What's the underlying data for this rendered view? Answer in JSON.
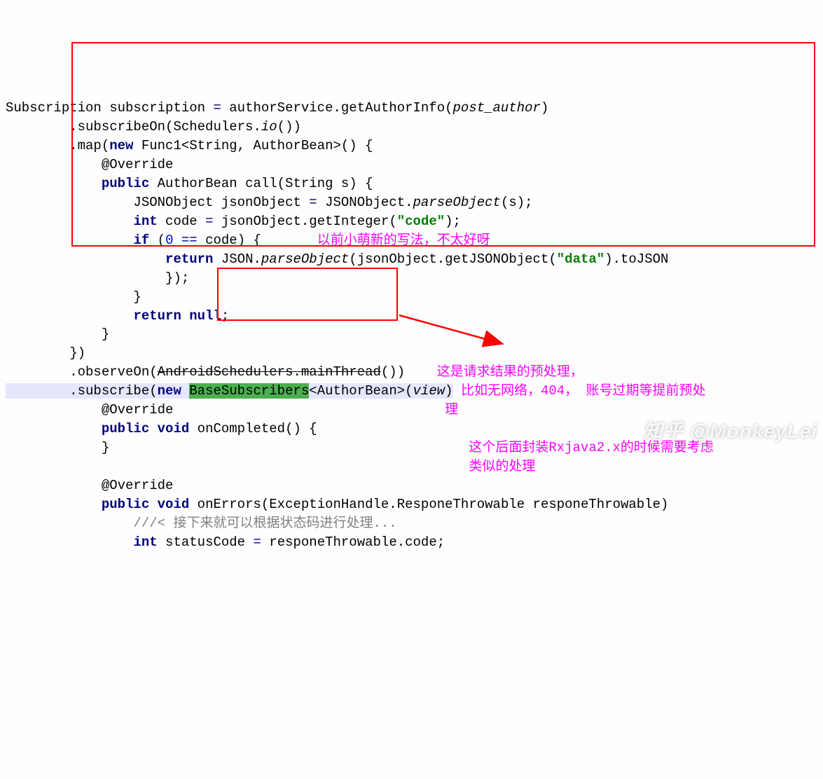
{
  "code": {
    "line1": {
      "pre": "Subscription subscription ",
      "op": "=",
      "post": " authorService.getAuthorInfo(",
      "arg": "post_author",
      "end": ")"
    },
    "line2": {
      "indent": "        .subscribeOn(Schedulers.",
      "method": "io",
      "end": "())"
    },
    "line3": {
      "indent": "        .map(",
      "kw": "new",
      "gen": " Func1<String, AuthorBean>",
      "end": "() {"
    },
    "line4": {
      "indent": "            ",
      "ann": "@Override"
    },
    "line5": {
      "indent": "            ",
      "acc": "public",
      "ret": " AuthorBean ",
      "name": "call",
      "args": "(String s) {"
    },
    "line6": {
      "indent": "                JSONObject jsonObject ",
      "op": "=",
      "post": " JSONObject.",
      "m": "parseObject",
      "args": "(s);"
    },
    "line7": {
      "indent": "                ",
      "typ": "int",
      "post": " code ",
      "op": "=",
      "post2": " jsonObject.getInteger(",
      "str": "\"code\"",
      "end": ");"
    },
    "line8": {
      "indent": "                ",
      "kw": "if",
      "post": " (",
      "num": "0",
      "op": " == ",
      "var": "code) {",
      "note": "        以前小萌新的写法，不太好呀"
    },
    "line9": {
      "indent": "                    ",
      "kw": "return",
      "post": " JSON.",
      "m": "parseObject",
      "args": "(jsonObject.getJSONObject(",
      "str": "\"data\"",
      "end": ").toJSON"
    },
    "line10": {
      "indent": "                    });"
    },
    "line11": {
      "indent": "                }"
    },
    "line12": {
      "indent": "                ",
      "kw": "return",
      "post": " ",
      "nul": "null",
      "end": ";"
    },
    "line13": {
      "indent": "            }"
    },
    "line14": {
      "indent": "        })"
    },
    "line15": {
      "indent": "        .observeOn(",
      "strike": "AndroidSchedulers.mainThread",
      "end": "())",
      "note": "    这是请求结果的预处理，"
    },
    "line16": {
      "indent": "        .subscribe(",
      "kw": "new",
      "sp": " ",
      "hl": "BaseSubscribers",
      "gen": "<AuthorBean>(",
      "arg": "view",
      "end": ")",
      "note": " 比如无网络，404， 账号过期等提前预处"
    },
    "line17": {
      "indent": "            ",
      "ann": "@Override",
      "note": "                                  理"
    },
    "line18": {
      "indent": "            ",
      "acc": "public",
      "sp": " ",
      "void": "void",
      "name": " onCompleted",
      "args": "() {"
    },
    "line19": {
      "indent": "            }",
      "note": "                                             这个后面封装Rxjava2.x的时候需要考虑"
    },
    "line20": {
      "indent": "",
      "note": "                                                         类似的处理"
    },
    "line21": {
      "indent": "            ",
      "ann": "@Override"
    },
    "line22": {
      "indent": "            ",
      "acc": "public",
      "sp": " ",
      "void": "void",
      "name": " onErrors",
      "args": "(ExceptionHandle.ResponeThrowable responeThrowable)"
    },
    "line23": {
      "indent": "                ",
      "cmt": "///< 接下来就可以根据状态码进行处理..."
    },
    "line24": {
      "indent": "                ",
      "typ": "int",
      "post": " statusCode ",
      "op": "=",
      "post2": " responeThrowable.code;"
    }
  },
  "annotations": {
    "note1": "以前小萌新的写法，不太好呀",
    "note2a": "这是请求结果的预处理，",
    "note2b": "比如无网络，404， 账号过期等提前预处",
    "note2c": "理",
    "note3a": "这个后面封装Rxjava2.x的时候需要考虑",
    "note3b": "类似的处理"
  },
  "watermark": "知乎 @MonkeyLei"
}
